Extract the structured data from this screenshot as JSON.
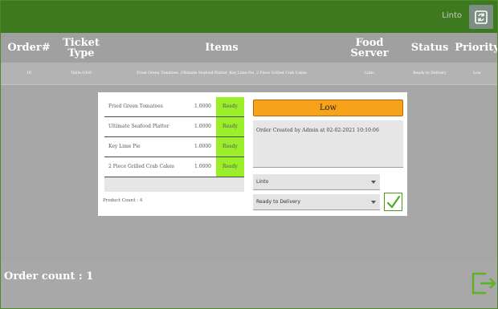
{
  "topbar": {
    "user": "Linto",
    "refresh_icon": "refresh-icon"
  },
  "table": {
    "headers": [
      {
        "key": "order",
        "label": "Order#"
      },
      {
        "key": "ticket",
        "label": "Ticket Type"
      },
      {
        "key": "items",
        "label": "Items"
      },
      {
        "key": "server",
        "label": "Food Server"
      },
      {
        "key": "status",
        "label": "Status"
      },
      {
        "key": "priority",
        "label": "Priority"
      }
    ],
    "rows": [
      {
        "order": "10",
        "ticket": "Table:1016",
        "items": "Fried Green Tomatoes ,Ultimate Seafood Platter ,Key Lime Pie ,2 Piece Grilled Crab Cakes",
        "server": "Linto",
        "status": "Ready to Delivery",
        "priority": "Low"
      }
    ]
  },
  "modal": {
    "items": [
      {
        "name": "Fried Green Tomatoes",
        "qty": "1.0000",
        "status": "Ready"
      },
      {
        "name": "Ultimate Seafood Platter",
        "qty": "1.0000",
        "status": "Ready"
      },
      {
        "name": "Key Lime Pie",
        "qty": "1.0000",
        "status": "Ready"
      },
      {
        "name": "2 Piece Grilled Crab Cakes",
        "qty": "1.0000",
        "status": "Ready"
      }
    ],
    "product_count": "Product Count : 4",
    "priority": "Low",
    "note": "Order Created by Admin at 02-02-2021 10:10:06",
    "server_select": "Linto",
    "status_select": "Ready to Delivery"
  },
  "footer": {
    "order_count": "Order count : 1"
  },
  "colors": {
    "topbar": "#3d7a1f",
    "accent_green": "#9aee2a",
    "priority_orange": "#f7a21b",
    "exit_green": "#5cb21f"
  }
}
